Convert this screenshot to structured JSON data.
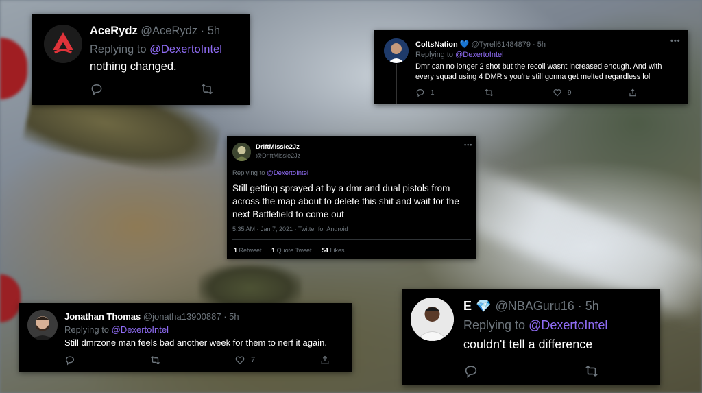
{
  "tweets": [
    {
      "display_name": "AceRydz",
      "handle": "@AceRydz",
      "time": "· 5h",
      "replying_prefix": "Replying to",
      "replying_to": "@DexertoIntel",
      "text": "nothing changed."
    },
    {
      "display_name": "ColtsNation",
      "handle": "@Tyrell61484879",
      "time": "· 5h",
      "verified_heart": "💙",
      "replying_prefix": "Replying to",
      "replying_to": "@DexertoIntel",
      "text": "Dmr can no longer 2 shot but the recoil wasnt increased enough. And with every squad using 4 DMR's you're still gonna get melted regardless lol",
      "reply_count": "1",
      "like_count": "9"
    },
    {
      "display_name": "DriftMissle2Jz",
      "handle": "@DriftMissle2Jz",
      "replying_prefix": "Replying to",
      "replying_to": "@DexertoIntel",
      "text": "Still getting sprayed at by a dmr and dual pistols from across the map about to delete this shit and wait for the next Battlefield to come out",
      "timestamp": "5:35 AM · Jan 7, 2021 · Twitter for Android",
      "retweets_count": "1",
      "retweets_label": "Retweet",
      "quote_count": "1",
      "quote_label": "Quote Tweet",
      "likes_count": "54",
      "likes_label": "Likes"
    },
    {
      "display_name": "Jonathan Thomas",
      "handle": "@jonatha13900887",
      "time": "· 5h",
      "replying_prefix": "Replying to",
      "replying_to": "@DexertoIntel",
      "text": "Still dmrzone man feels bad another week for them to nerf it again.",
      "like_count": "7"
    },
    {
      "display_name": "E",
      "badge": "💎",
      "handle": "@NBAGuru16",
      "time": "· 5h",
      "replying_prefix": "Replying to",
      "replying_to": "@DexertoIntel",
      "text": "couldn't tell a difference"
    }
  ],
  "colors": {
    "card_bg": "#000000",
    "mention": "#8f6cf4",
    "muted": "#6e767d",
    "text": "#ffffff"
  },
  "icons": [
    "reply-icon",
    "retweet-icon",
    "like-icon",
    "share-icon",
    "more-icon"
  ]
}
